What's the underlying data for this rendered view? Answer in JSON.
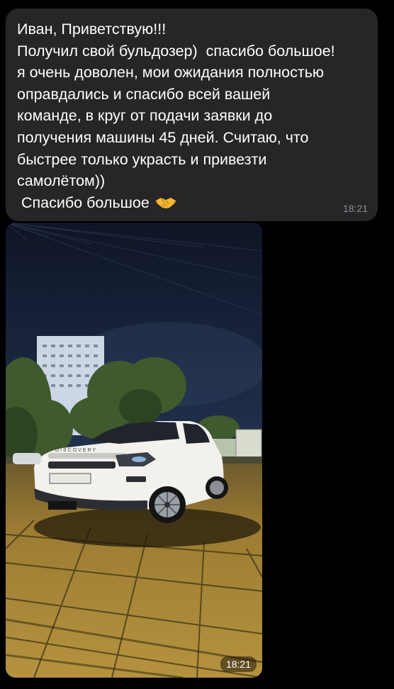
{
  "message": {
    "lines": [
      "Иван, Приветствую!!!",
      "Получил свой бульдозер)  спасибо большое!",
      "я очень доволен, мои ожидания полностью",
      "оправдались и спасибо всей вашей",
      "команде, в круг от подачи заявки до",
      "получения машины 45 дней. Считаю, что",
      "быстрее только украсть и привезти",
      "самолётом))",
      " Спасибо большое"
    ],
    "emoji": "handshake-icon",
    "time": "18:21"
  },
  "photo": {
    "subject": "white-suv-photo",
    "car_badge": "DISCOVERY",
    "time": "18:21"
  },
  "colors": {
    "bubble": "#262628",
    "background": "#000000",
    "timestamp": "#8e8e93"
  }
}
